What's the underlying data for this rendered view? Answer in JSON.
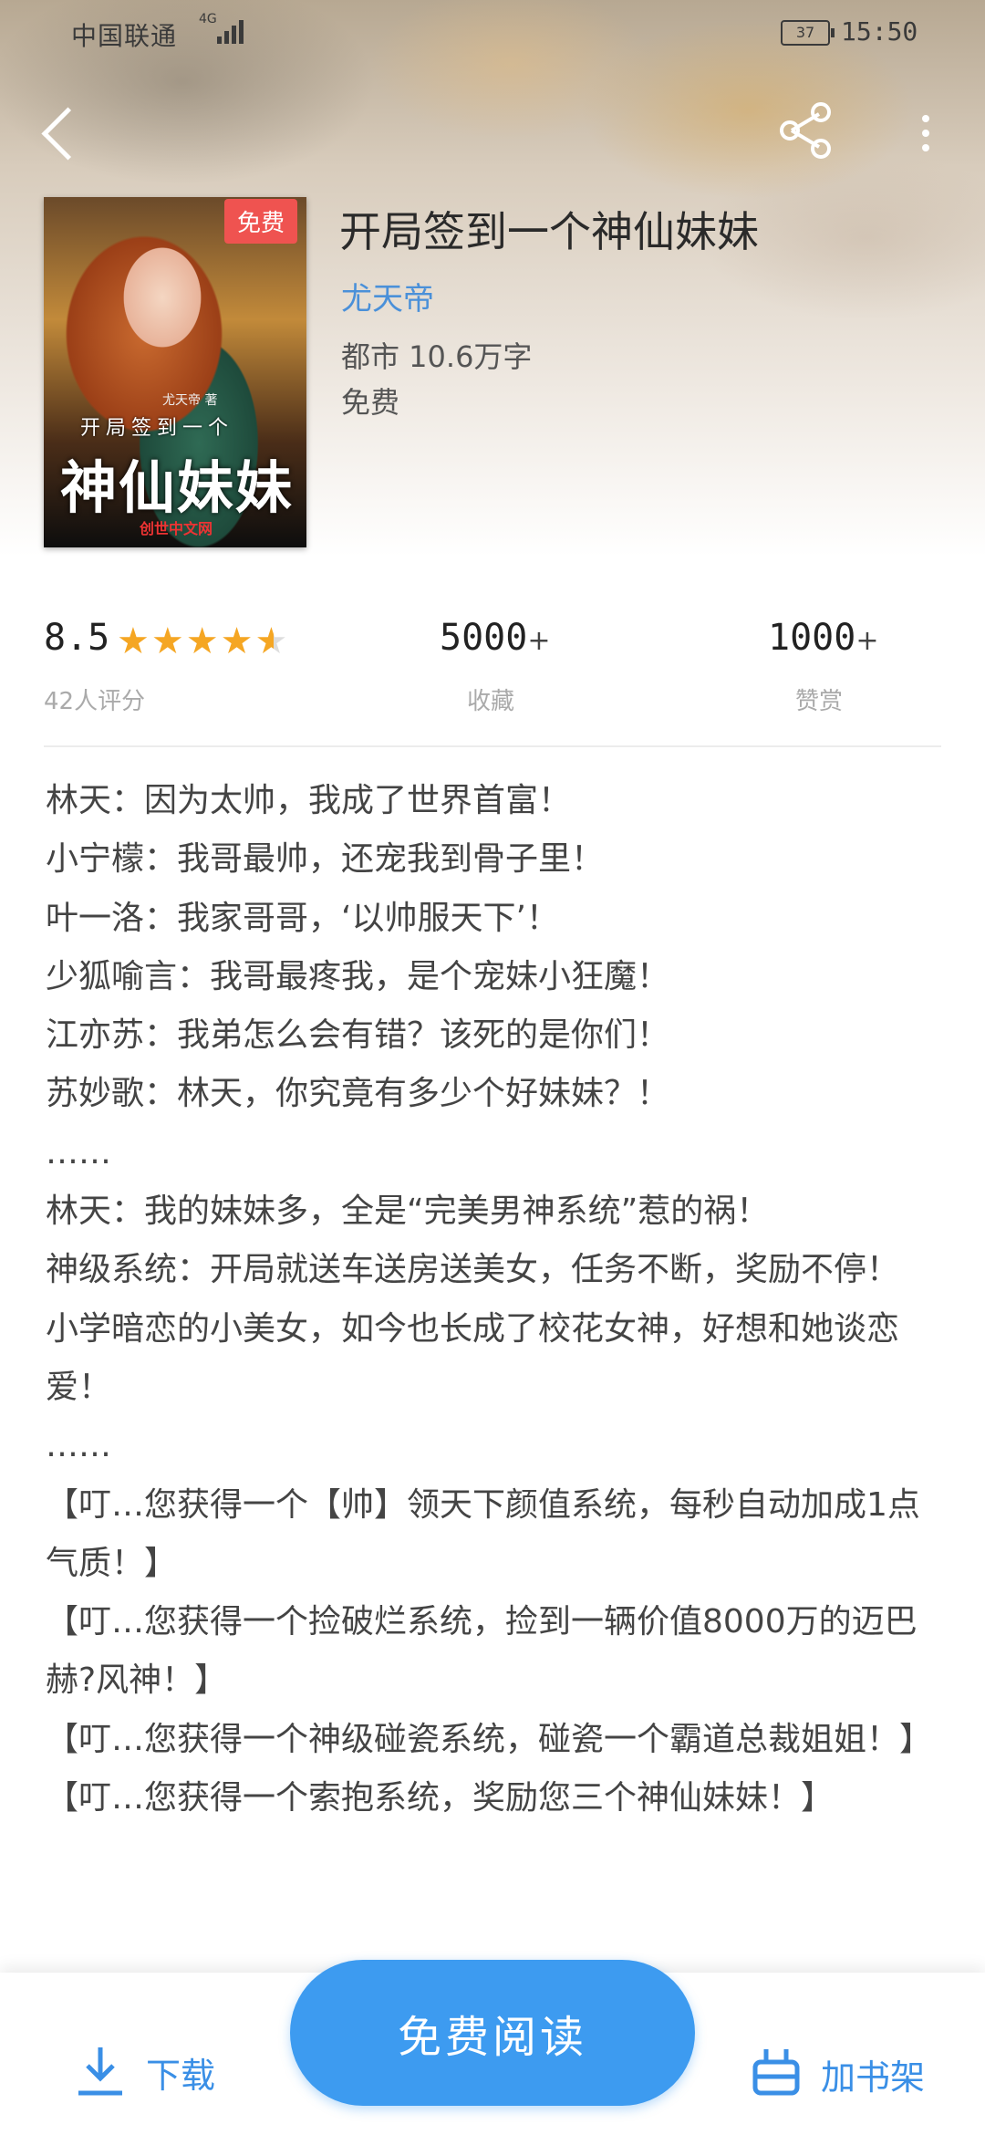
{
  "status": {
    "carrier": "中国联通",
    "network": "4G",
    "battery": "37",
    "time": "15:50"
  },
  "book": {
    "title": "开局签到一个神仙妹妹",
    "author": "尤天帝",
    "meta": "都市  10.6万字",
    "price": "免费",
    "cover_tag": "免费",
    "cover_author": "尤天帝 著",
    "cover_subtitle": "开局签到一个",
    "cover_title": "神仙妹妹",
    "cover_publisher": "创世中文网"
  },
  "stats": {
    "rating": "8.5",
    "rating_stars": 4.5,
    "rating_label": "42人评分",
    "favorites": "5000",
    "favorites_label": "收藏",
    "rewards": "1000",
    "rewards_label": "赞赏",
    "plus": "+"
  },
  "intro": [
    "林天：因为太帅，我成了世界首富！",
    "小宁檬：我哥最帅，还宠我到骨子里！",
    "叶一洛：我家哥哥，‘以帅服天下’！",
    "少狐喻言：我哥最疼我，是个宠妹小狂魔！",
    "江亦苏：我弟怎么会有错？该死的是你们！",
    "苏妙歌：林天，你究竟有多少个好妹妹？！",
    "……",
    "林天：我的妹妹多，全是“完美男神系统”惹的祸！",
    "神级系统：开局就送车送房送美女，任务不断，奖励不停！",
    "小学暗恋的小美女，如今也长成了校花女神，好想和她谈恋爱！",
    "……",
    "【叮…您获得一个【帅】领天下颜值系统，每秒自动加成1点气质！】",
    "【叮…您获得一个捡破烂系统，捡到一辆价值8000万的迈巴赫?风神！】",
    "【叮…您获得一个神级碰瓷系统，碰瓷一个霸道总裁姐姐！】",
    "【叮…您获得一个索抱系统，奖励您三个神仙妹妹！】"
  ],
  "bottom": {
    "download_label": "下载",
    "read_label": "免费阅读",
    "shelf_label": "加书架"
  },
  "colors": {
    "accent": "#3d9bf0",
    "author": "#4a90d9",
    "star": "#f5a623",
    "tag": "#ef5350"
  }
}
